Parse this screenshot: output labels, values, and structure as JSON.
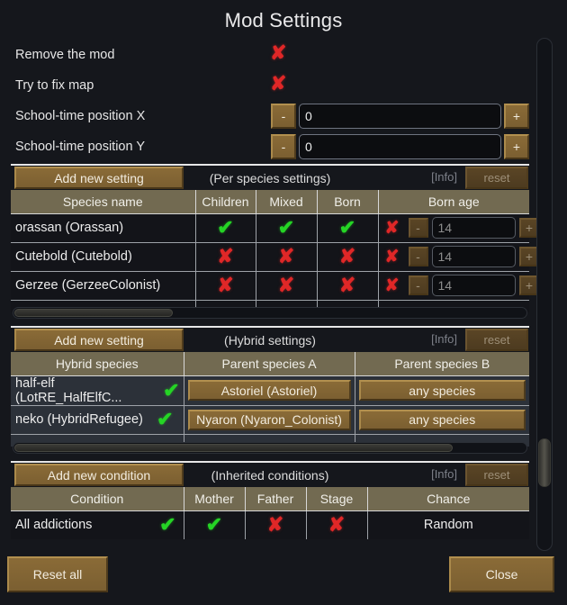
{
  "window": {
    "title": "Mod Settings"
  },
  "top_options": [
    {
      "label": "Remove the mod",
      "value_icon": "cross-icon",
      "state": false
    },
    {
      "label": "Try to fix map",
      "value_icon": "cross-icon",
      "state": false
    }
  ],
  "top_numeric": [
    {
      "label": "School-time position X",
      "minus": "-",
      "plus": "+",
      "value": "0"
    },
    {
      "label": "School-time position Y",
      "minus": "-",
      "plus": "+",
      "value": "0"
    }
  ],
  "species_section": {
    "add_button": "Add new setting",
    "caption": "(Per species settings)",
    "info": "[Info]",
    "reset": "reset",
    "columns": [
      "Species name",
      "Children",
      "Mixed",
      "Born",
      "Born age"
    ],
    "rows": [
      {
        "name": "orassan (Orassan)",
        "children": true,
        "mixed": true,
        "born": true,
        "born_age_enabled": false,
        "born_age_minus": "-",
        "born_age_value": "14",
        "born_age_plus": "+"
      },
      {
        "name": "Cutebold (Cutebold)",
        "children": false,
        "mixed": false,
        "born": false,
        "born_age_enabled": false,
        "born_age_minus": "-",
        "born_age_value": "14",
        "born_age_plus": "+"
      },
      {
        "name": "Gerzee (GerzeeColonist)",
        "children": false,
        "mixed": false,
        "born": false,
        "born_age_enabled": false,
        "born_age_minus": "-",
        "born_age_value": "14",
        "born_age_plus": "+"
      }
    ]
  },
  "hybrid_section": {
    "add_button": "Add new setting",
    "caption": "(Hybrid settings)",
    "info": "[Info]",
    "reset": "reset",
    "columns": [
      "Hybrid species",
      "Parent species A",
      "Parent species B"
    ],
    "rows": [
      {
        "name": "half-elf (LotRE_HalfElfC...",
        "enabled": true,
        "parent_a": "Astoriel (Astoriel)",
        "parent_b": "any species"
      },
      {
        "name": "neko (HybridRefugee)",
        "enabled": true,
        "parent_a": "Nyaron (Nyaron_Colonist)",
        "parent_b": "any species"
      }
    ]
  },
  "conditions_section": {
    "add_button": "Add new condition",
    "caption": "(Inherited conditions)",
    "info": "[Info]",
    "reset": "reset",
    "columns": [
      "Condition",
      "Mother",
      "Father",
      "Stage",
      "Chance"
    ],
    "rows": [
      {
        "condition": "All addictions",
        "enabled": true,
        "mother": true,
        "father": false,
        "stage": false,
        "chance": "Random"
      }
    ]
  },
  "footer": {
    "reset_all": "Reset all",
    "close": "Close"
  },
  "glyphs": {
    "check": "✔",
    "cross": "✘"
  },
  "colors": {
    "background": "#15171c",
    "button_brown": "#7b5f31",
    "header_olive": "#726a51",
    "check_green": "#25d425",
    "cross_red": "#e02727",
    "text": "#e8e8e8"
  }
}
